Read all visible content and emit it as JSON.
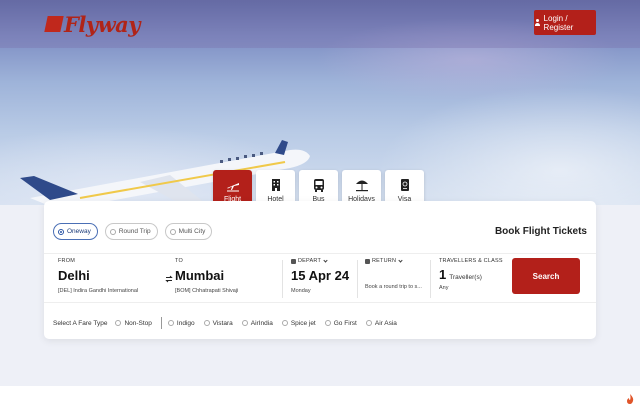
{
  "header": {
    "brand": "Flyway",
    "login_label": "Login / Register"
  },
  "services": [
    {
      "label": "Flight",
      "icon": "plane-icon",
      "active": true
    },
    {
      "label": "Hotel",
      "icon": "hotel-icon",
      "active": false
    },
    {
      "label": "Bus",
      "icon": "bus-icon",
      "active": false
    },
    {
      "label": "Holidays",
      "icon": "beach-umbrella-icon",
      "active": false
    },
    {
      "label": "Visa",
      "icon": "passport-icon",
      "active": false
    }
  ],
  "search": {
    "title": "Book Flight Tickets",
    "trip_types": [
      {
        "label": "Oneway",
        "selected": true
      },
      {
        "label": "Round Trip",
        "selected": false
      },
      {
        "label": "Multi City",
        "selected": false
      }
    ],
    "from": {
      "label": "FROM",
      "city": "Delhi",
      "airport": "[DEL] Indira Gandhi International"
    },
    "to": {
      "label": "TO",
      "city": "Mumbai",
      "airport": "[BOM] Chhatrapati Shivaji"
    },
    "depart": {
      "label": "DEPART",
      "date": "15 Apr 24",
      "day": "Monday"
    },
    "return": {
      "label": "RETURN",
      "hint": "Book a round trip to s..."
    },
    "travellers": {
      "label": "TRAVELLERS & CLASS",
      "count": "1",
      "unit": "Traveller(s)",
      "class": "Any"
    },
    "search_label": "Search"
  },
  "fare": {
    "label": "Select A Fare Type",
    "options": [
      "Non-Stop"
    ],
    "airlines": [
      "Indigo",
      "Vistara",
      "AirIndia",
      "Spice jet",
      "Go First",
      "Air Asia"
    ]
  },
  "colors": {
    "brand": "#b3201a",
    "accent": "#2a55a5"
  }
}
